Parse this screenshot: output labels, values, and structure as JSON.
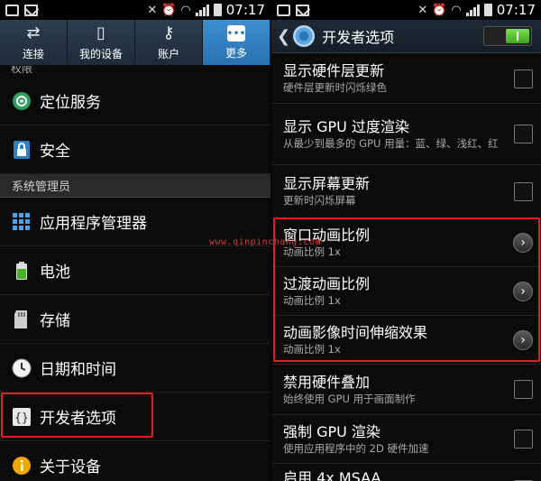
{
  "status_bar": {
    "time": "07:17"
  },
  "left": {
    "tabs": [
      {
        "label": "连接",
        "icon": "connections-icon",
        "active": false
      },
      {
        "label": "我的设备",
        "icon": "my-device-icon",
        "active": false
      },
      {
        "label": "账户",
        "icon": "account-key-icon",
        "active": false
      },
      {
        "label": "更多",
        "icon": "more-dots-icon",
        "active": true
      }
    ],
    "cut_section_label": "权限",
    "items_top": [
      {
        "label": "定位服务",
        "icon": "location-icon"
      },
      {
        "label": "安全",
        "icon": "lock-icon"
      }
    ],
    "section_header": "系统管理员",
    "items_bottom": [
      {
        "label": "应用程序管理器",
        "icon": "app-grid-icon"
      },
      {
        "label": "电池",
        "icon": "battery-icon"
      },
      {
        "label": "存储",
        "icon": "sd-card-icon"
      },
      {
        "label": "日期和时间",
        "icon": "clock-icon"
      },
      {
        "label": "开发者选项",
        "icon": "braces-icon"
      },
      {
        "label": "关于设备",
        "icon": "info-icon"
      }
    ]
  },
  "right": {
    "title": "开发者选项",
    "settings": [
      {
        "title": "显示硬件层更新",
        "subtitle": "硬件层更新时闪烁绿色",
        "control": "checkbox"
      },
      {
        "title": "显示 GPU 过度渲染",
        "subtitle": "从最少到最多的 GPU 用量：蓝、绿、浅红、红",
        "control": "checkbox"
      },
      {
        "title": "显示屏幕更新",
        "subtitle": "更新时闪烁屏幕",
        "control": "checkbox"
      },
      {
        "title": "窗口动画比例",
        "subtitle": "动画比例 1x",
        "control": "chevron"
      },
      {
        "title": "过渡动画比例",
        "subtitle": "动画比例 1x",
        "control": "chevron"
      },
      {
        "title": "动画影像时间伸缩效果",
        "subtitle": "动画比例 1x",
        "control": "chevron"
      },
      {
        "title": "禁用硬件叠加",
        "subtitle": "始终使用 GPU 用于画面制作",
        "control": "checkbox"
      },
      {
        "title": "强制 GPU 渲染",
        "subtitle": "使用应用程序中的 2D 硬件加速",
        "control": "checkbox"
      },
      {
        "title": "启用 4x MSAA",
        "subtitle": "",
        "control": "checkbox"
      }
    ],
    "watermark": "www.qinpinchang.com"
  },
  "colors": {
    "highlight": "#e02020",
    "tab_active": "#2a72b0",
    "switch_on": "#4fc02a"
  }
}
